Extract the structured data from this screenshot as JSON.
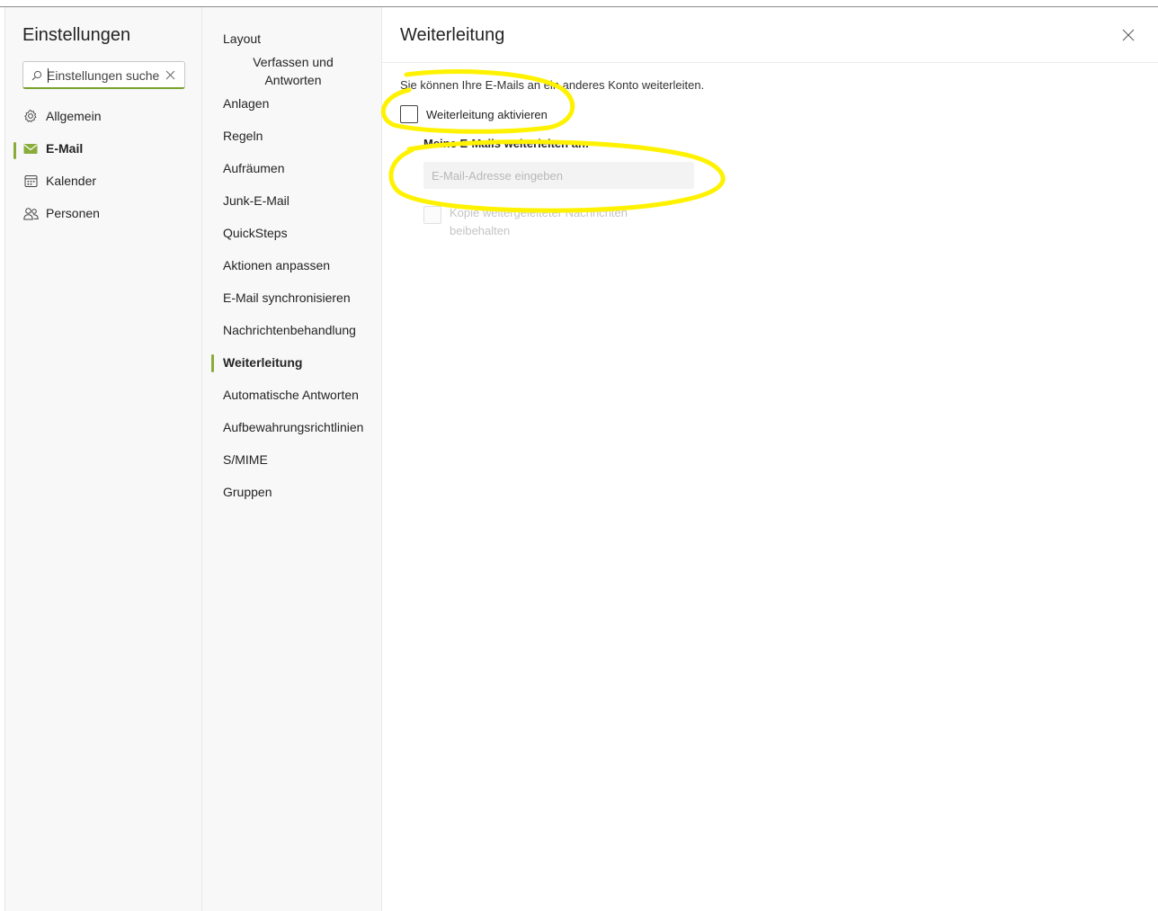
{
  "settings": {
    "title": "Einstellungen",
    "search": {
      "value": "",
      "placeholder": "Einstellungen suchen"
    }
  },
  "categories": [
    {
      "label": "Allgemein",
      "icon": "gear-icon"
    },
    {
      "label": "E-Mail",
      "icon": "mail-icon",
      "active": true
    },
    {
      "label": "Kalender",
      "icon": "calendar-icon"
    },
    {
      "label": "Personen",
      "icon": "people-icon"
    }
  ],
  "mail_settings": [
    {
      "label": "Layout"
    },
    {
      "label": "Verfassen und Antworten"
    },
    {
      "label": "Anlagen"
    },
    {
      "label": "Regeln"
    },
    {
      "label": "Aufräumen"
    },
    {
      "label": "Junk-E-Mail"
    },
    {
      "label": "QuickSteps"
    },
    {
      "label": "Aktionen anpassen"
    },
    {
      "label": "E-Mail synchronisieren"
    },
    {
      "label": "Nachrichtenbehandlung"
    },
    {
      "label": "Weiterleitung",
      "active": true
    },
    {
      "label": "Automatische Antworten"
    },
    {
      "label": "Aufbewahrungsrichtlinien"
    },
    {
      "label": "S/MIME"
    },
    {
      "label": "Gruppen"
    }
  ],
  "page": {
    "title": "Weiterleitung",
    "description": "Sie können Ihre E-Mails an ein anderes Konto weiterleiten.",
    "enable_forwarding": {
      "label": "Weiterleitung aktivieren",
      "checked": false
    },
    "forward_to": {
      "label": "Meine E-Mails weiterleiten an:",
      "value": "",
      "placeholder": "E-Mail-Adresse eingeben"
    },
    "keep_copy": {
      "label": "Kopie weitergeleiteter Nachrichten beibehalten",
      "checked": false,
      "disabled": true
    }
  },
  "colors": {
    "accent": "#8aac3a",
    "annotation": "#fff200",
    "sidebar_bg": "#f8f8f8"
  }
}
